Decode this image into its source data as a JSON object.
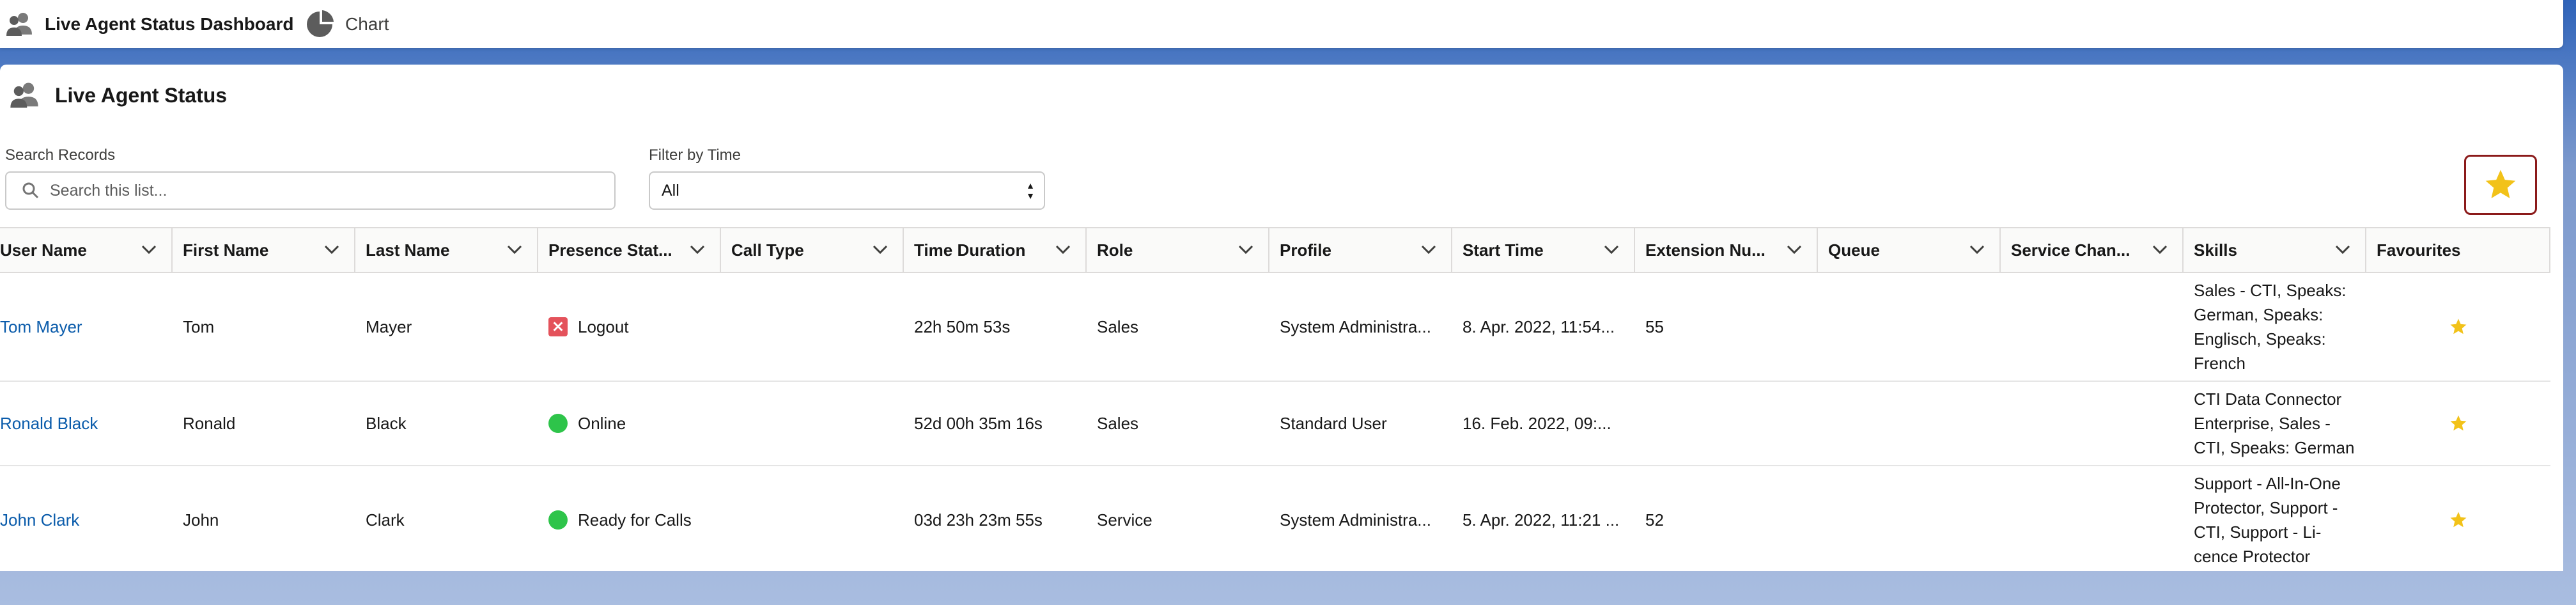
{
  "tabs": [
    {
      "label": "Live Agent Status Dashboard",
      "icon": "user-group-icon"
    },
    {
      "label": "Chart",
      "icon": "pie-chart-icon"
    }
  ],
  "card": {
    "title": "Live Agent Status",
    "search": {
      "label": "Search Records",
      "placeholder": "Search this list...",
      "value": ""
    },
    "filter": {
      "label": "Filter by Time",
      "selected": "All"
    }
  },
  "colors": {
    "accent_star": "#f2c219",
    "link": "#0b5cab",
    "online": "#2ec44a",
    "logout": "#e4525b",
    "fav_button_border": "#8b1a1a"
  },
  "columns": [
    "User Name",
    "First Name",
    "Last Name",
    "Presence Stat...",
    "Call Type",
    "Time Duration",
    "Role",
    "Profile",
    "Start Time",
    "Extension Nu...",
    "Queue",
    "Service Chan...",
    "Skills",
    "Favourites"
  ],
  "rows": [
    {
      "user_name": "Tom Mayer",
      "first_name": "Tom",
      "last_name": "Mayer",
      "presence": "Logout",
      "presence_kind": "logout",
      "call_type": "",
      "duration": "22h 50m 53s",
      "role": "Sales",
      "profile": "System Administra...",
      "start_time": "8. Apr. 2022, 11:54...",
      "extension": "55",
      "queue": "",
      "service_channel": "",
      "skills": "Sales - CTI, Speaks: German, Speaks: Englisch, Speaks: French"
    },
    {
      "user_name": "Ronald Black",
      "first_name": "Ronald",
      "last_name": "Black",
      "presence": "Online",
      "presence_kind": "online",
      "call_type": "",
      "duration": "52d 00h 35m 16s",
      "role": "Sales",
      "profile": "Standard User",
      "start_time": "16. Feb. 2022, 09:...",
      "extension": "",
      "queue": "",
      "service_channel": "",
      "skills": "CTI Data Connector Enterprise, Sales - CTI, Speaks: German"
    },
    {
      "user_name": "John Clark",
      "first_name": "John",
      "last_name": "Clark",
      "presence": "Ready for Calls",
      "presence_kind": "online",
      "call_type": "",
      "duration": "03d 23h 23m 55s",
      "role": "Service",
      "profile": "System Administra...",
      "start_time": "5. Apr. 2022, 11:21 ...",
      "extension": "52",
      "queue": "",
      "service_channel": "",
      "skills": "Support - All-In-One Protector, Support - CTI, Support - Li- cence Protector"
    }
  ]
}
